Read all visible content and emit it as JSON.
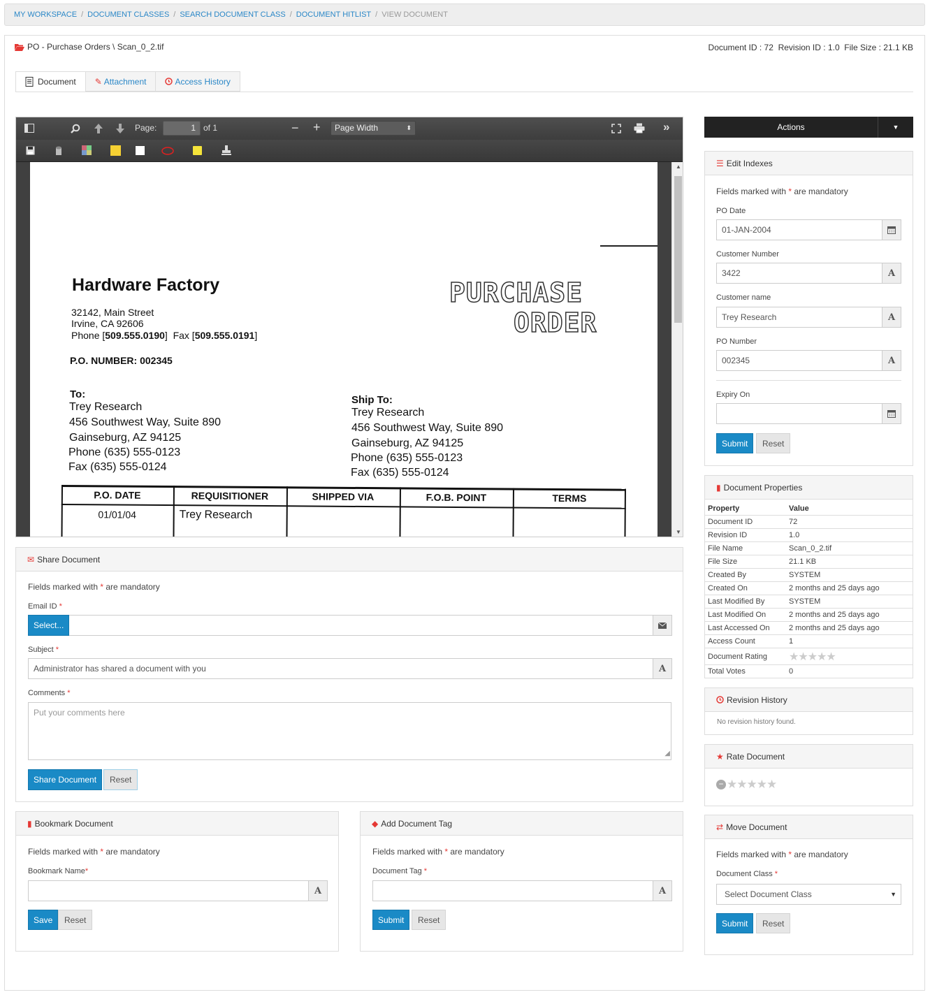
{
  "breadcrumb": {
    "items": [
      "MY WORKSPACE",
      "DOCUMENT CLASSES",
      "SEARCH DOCUMENT CLASS",
      "DOCUMENT HITLIST"
    ],
    "current": "VIEW DOCUMENT"
  },
  "header": {
    "title": "PO - Purchase Orders \\ Scan_0_2.tif",
    "meta": "Document ID : 72  Revision ID : 1.0  File Size : 21.1 KB"
  },
  "tabs": [
    {
      "label": "Document"
    },
    {
      "label": "Attachment"
    },
    {
      "label": "Access History"
    }
  ],
  "viewer": {
    "page_label": "Page:",
    "page_num": "1",
    "page_of": "of 1",
    "zoom": "Page Width"
  },
  "scan": {
    "company": "Hardware Factory",
    "addr1": "32142, Main Street",
    "addr2": "Irvine, CA 92606",
    "phone_pre": "Phone [",
    "phone": "509.555.0190",
    "fax_pre": "]  Fax [",
    "fax": "509.555.0191",
    "fax_post": "]",
    "po_number": "P.O. NUMBER: 002345",
    "heading1": "PURCHASE",
    "heading2": "ORDER",
    "to_label": "To:",
    "to": [
      "Trey Research",
      "456 Southwest Way, Suite 890",
      "Gainseburg, AZ 94125",
      "Phone (635) 555-0123",
      "Fax (635) 555-0124"
    ],
    "ship_label": "Ship To:",
    "ship": [
      "Trey Research",
      "456 Southwest Way, Suite 890",
      "Gainseburg, AZ 94125",
      "Phone (635) 555-0123",
      "Fax (635) 555-0124"
    ],
    "cols": [
      "P.O. DATE",
      "REQUISITIONER",
      "SHIPPED VIA",
      "F.O.B. POINT",
      "TERMS"
    ],
    "row": [
      "01/01/04",
      "Trey Research"
    ]
  },
  "actions": {
    "label": "Actions"
  },
  "edit_indexes": {
    "title": "Edit Indexes",
    "mandatory_pre": "Fields marked with ",
    "mandatory_post": " are mandatory",
    "po_date_label": "PO Date",
    "po_date": "01-JAN-2004",
    "cust_num_label": "Customer Number",
    "cust_num": "3422",
    "cust_name_label": "Customer name",
    "cust_name": "Trey Research",
    "po_num_label": "PO Number",
    "po_num": "002345",
    "expiry_label": "Expiry On",
    "expiry": "",
    "submit": "Submit",
    "reset": "Reset"
  },
  "doc_props": {
    "title": "Document Properties",
    "col_property": "Property",
    "col_value": "Value",
    "rows": [
      {
        "k": "Document ID",
        "v": "72"
      },
      {
        "k": "Revision ID",
        "v": "1.0"
      },
      {
        "k": "File Name",
        "v": "Scan_0_2.tif"
      },
      {
        "k": "File Size",
        "v": "21.1 KB"
      },
      {
        "k": "Created By",
        "v": "SYSTEM"
      },
      {
        "k": "Created On",
        "v": "2 months and 25 days ago"
      },
      {
        "k": "Last Modified By",
        "v": "SYSTEM"
      },
      {
        "k": "Last Modified On",
        "v": "2 months and 25 days ago"
      },
      {
        "k": "Last Accessed On",
        "v": "2 months and 25 days ago"
      },
      {
        "k": "Access Count",
        "v": "1"
      }
    ],
    "rating_label": "Document Rating",
    "rating": 0,
    "votes_label": "Total Votes",
    "votes": "0"
  },
  "revision": {
    "title": "Revision History",
    "empty": "No revision history found."
  },
  "rate": {
    "title": "Rate Document"
  },
  "move": {
    "title": "Move Document",
    "mandatory_pre": "Fields marked with ",
    "mandatory_post": " are mandatory",
    "class_label": "Document Class ",
    "class_placeholder": "Select Document Class",
    "submit": "Submit",
    "reset": "Reset"
  },
  "share": {
    "title": "Share Document",
    "mandatory_pre": "Fields marked with ",
    "mandatory_post": " are mandatory",
    "email_label": "Email ID ",
    "select": "Select...",
    "subject_label": "Subject ",
    "subject": "Administrator has shared a document with you",
    "comments_label": "Comments ",
    "comments_placeholder": "Put your comments here",
    "share_btn": "Share Document",
    "reset": "Reset"
  },
  "bookmark": {
    "title": "Bookmark Document",
    "mandatory_pre": "Fields marked with ",
    "mandatory_post": " are mandatory",
    "name_label": "Bookmark Name",
    "save": "Save",
    "reset": "Reset"
  },
  "tag": {
    "title": "Add Document Tag",
    "mandatory_pre": "Fields marked with ",
    "mandatory_post": " are mandatory",
    "tag_label": "Document Tag ",
    "submit": "Submit",
    "reset": "Reset"
  },
  "colors": {
    "primary": "#1a8ac6",
    "accent": "#e53935",
    "link": "#2a87c7"
  }
}
